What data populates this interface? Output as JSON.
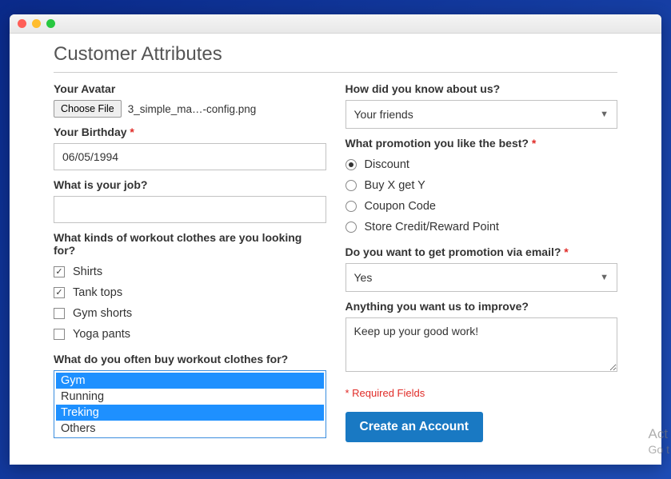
{
  "page": {
    "title": "Customer Attributes",
    "required_note": "* Required Fields",
    "submit_label": "Create an Account"
  },
  "avatar": {
    "label": "Your Avatar",
    "button": "Choose File",
    "filename": "3_simple_ma…-config.png"
  },
  "birthday": {
    "label": "Your Birthday",
    "required": "*",
    "value": "06/05/1994"
  },
  "job": {
    "label": "What is your job?",
    "value": ""
  },
  "workout_kinds": {
    "label": "What kinds of workout clothes are you looking for?",
    "options": [
      {
        "label": "Shirts",
        "checked": true
      },
      {
        "label": "Tank tops",
        "checked": true
      },
      {
        "label": "Gym shorts",
        "checked": false
      },
      {
        "label": "Yoga pants",
        "checked": false
      }
    ]
  },
  "buy_for": {
    "label": "What do you often buy workout clothes for?",
    "options": [
      {
        "label": "Gym",
        "selected": true
      },
      {
        "label": "Running",
        "selected": false
      },
      {
        "label": "Treking",
        "selected": true
      },
      {
        "label": "Others",
        "selected": false
      }
    ]
  },
  "know_about": {
    "label": "How did you know about us?",
    "value": "Your friends"
  },
  "promotion_best": {
    "label": "What promotion you like the best?",
    "required": "*",
    "options": [
      {
        "label": "Discount",
        "checked": true
      },
      {
        "label": "Buy X get Y",
        "checked": false
      },
      {
        "label": "Coupon Code",
        "checked": false
      },
      {
        "label": "Store Credit/Reward Point",
        "checked": false
      }
    ]
  },
  "promo_email": {
    "label": "Do you want to get promotion  via email?",
    "required": "*",
    "value": "Yes"
  },
  "improve": {
    "label": "Anything you want us to improve?",
    "value": "Keep up your good work!"
  },
  "watermark": {
    "l1": "Act",
    "l2": "Go t"
  }
}
